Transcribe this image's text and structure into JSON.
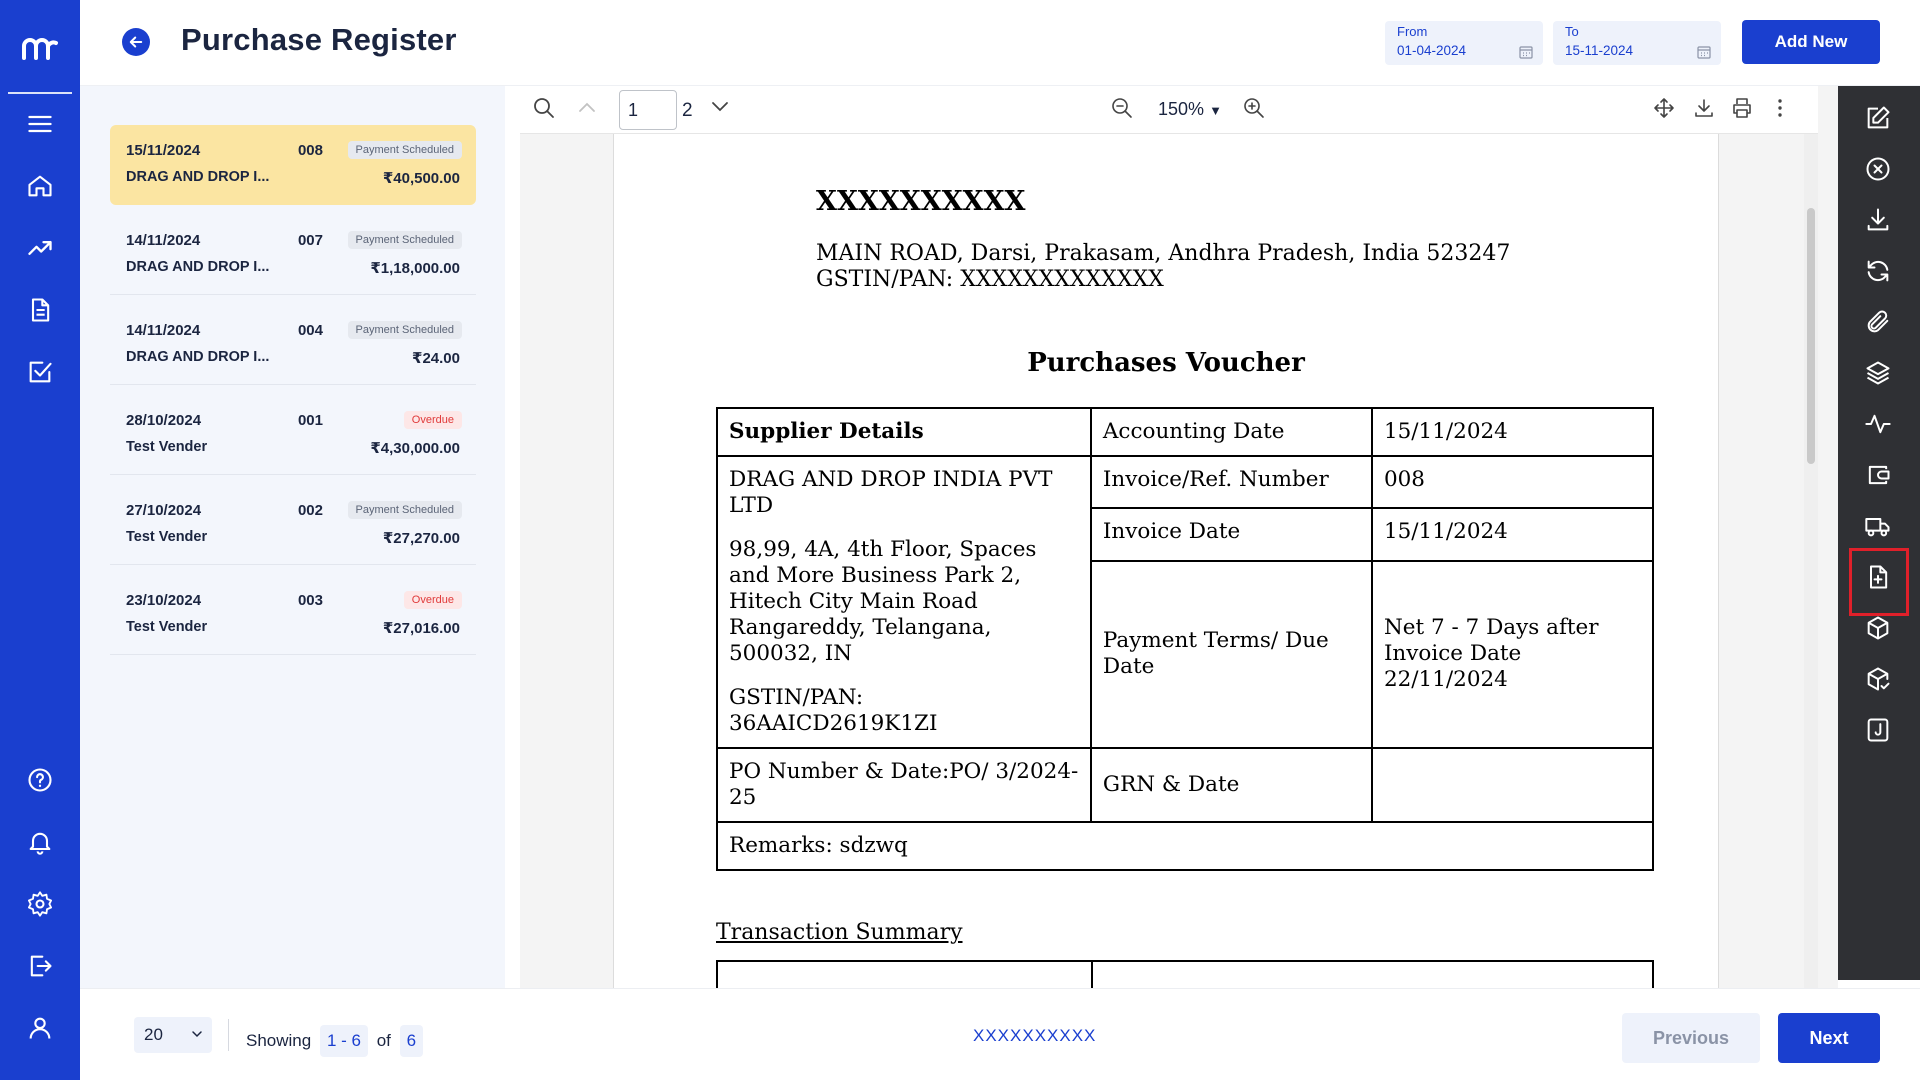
{
  "header": {
    "title": "Purchase Register",
    "from_label": "From",
    "from_value": "01-04-2024",
    "to_label": "To",
    "to_value": "15-11-2024",
    "add_new_label": "Add New"
  },
  "list": {
    "items": [
      {
        "date": "15/11/2024",
        "number": "008",
        "status": "Payment Scheduled",
        "vendor": "DRAG AND DROP I...",
        "amount": "₹40,500.00"
      },
      {
        "date": "14/11/2024",
        "number": "007",
        "status": "Payment Scheduled",
        "vendor": "DRAG AND DROP I...",
        "amount": "₹1,18,000.00"
      },
      {
        "date": "14/11/2024",
        "number": "004",
        "status": "Payment Scheduled",
        "vendor": "DRAG AND DROP I...",
        "amount": "₹24.00"
      },
      {
        "date": "28/10/2024",
        "number": "001",
        "status": "Overdue",
        "vendor": "Test Vender",
        "amount": "₹4,30,000.00"
      },
      {
        "date": "27/10/2024",
        "number": "002",
        "status": "Payment Scheduled",
        "vendor": "Test Vender",
        "amount": "₹27,270.00"
      },
      {
        "date": "23/10/2024",
        "number": "003",
        "status": "Overdue",
        "vendor": "Test Vender",
        "amount": "₹27,016.00"
      }
    ]
  },
  "viewer": {
    "page_current": "1",
    "page_total": "2",
    "zoom": "150%"
  },
  "document": {
    "company_name": "XXXXXXXXXX",
    "company_address": "MAIN ROAD, Darsi, Prakasam, Andhra Pradesh, India 523247",
    "company_gstin": "GSTIN/PAN: XXXXXXXXXXXXX",
    "voucher_title": "Purchases Voucher",
    "supplier_details_label": "Supplier Details",
    "accounting_date_label": "Accounting Date",
    "accounting_date": "15/11/2024",
    "supplier_name": "DRAG AND DROP INDIA PVT LTD",
    "supplier_address": "98,99, 4A, 4th Floor, Spaces and More Business Park 2, Hitech City Main Road Rangareddy, Telangana, 500032, IN",
    "supplier_gstin_label": "GSTIN/PAN:",
    "supplier_gstin": "36AAICD2619K1ZI",
    "invoice_ref_label": "Invoice/Ref. Number",
    "invoice_ref": "008",
    "invoice_date_label": "Invoice Date",
    "invoice_date": "15/11/2024",
    "payment_terms_label": "Payment Terms/ Due Date",
    "payment_terms_1": "Net 7 - 7 Days after Invoice Date",
    "payment_terms_2": "22/11/2024",
    "po_label": "PO Number & Date:PO/ 3/2024-25",
    "grn_label": "GRN & Date",
    "grn_value": "",
    "remarks": "Remarks: sdzwq",
    "transaction_summary": "Transaction Summary"
  },
  "footer": {
    "per_page": "20",
    "showing_label": "Showing",
    "range": "1 - 6",
    "of_label": "of",
    "total": "6",
    "company": "XXXXXXXXXX",
    "previous_label": "Previous",
    "next_label": "Next"
  },
  "icons": {
    "left_nav": [
      "logo-icon",
      "menu-icon",
      "home-icon",
      "trending-icon",
      "document-icon",
      "checkbox-icon",
      "help-icon",
      "bell-icon",
      "settings-icon",
      "logout-icon",
      "user-icon"
    ],
    "right_bar": [
      "edit-icon",
      "cancel-icon",
      "download-icon",
      "refresh-icon",
      "attachment-icon",
      "layers-icon",
      "activity-icon",
      "wallet-icon",
      "truck-icon",
      "file-plus-icon",
      "box-icon",
      "box-check-icon",
      "journal-icon"
    ]
  },
  "colors": {
    "primary": "#1a3fcf",
    "active_item": "#fbe5a2",
    "overdue": "#e03a3a",
    "right_bar": "#2f3034",
    "highlight": "#e0202a"
  }
}
